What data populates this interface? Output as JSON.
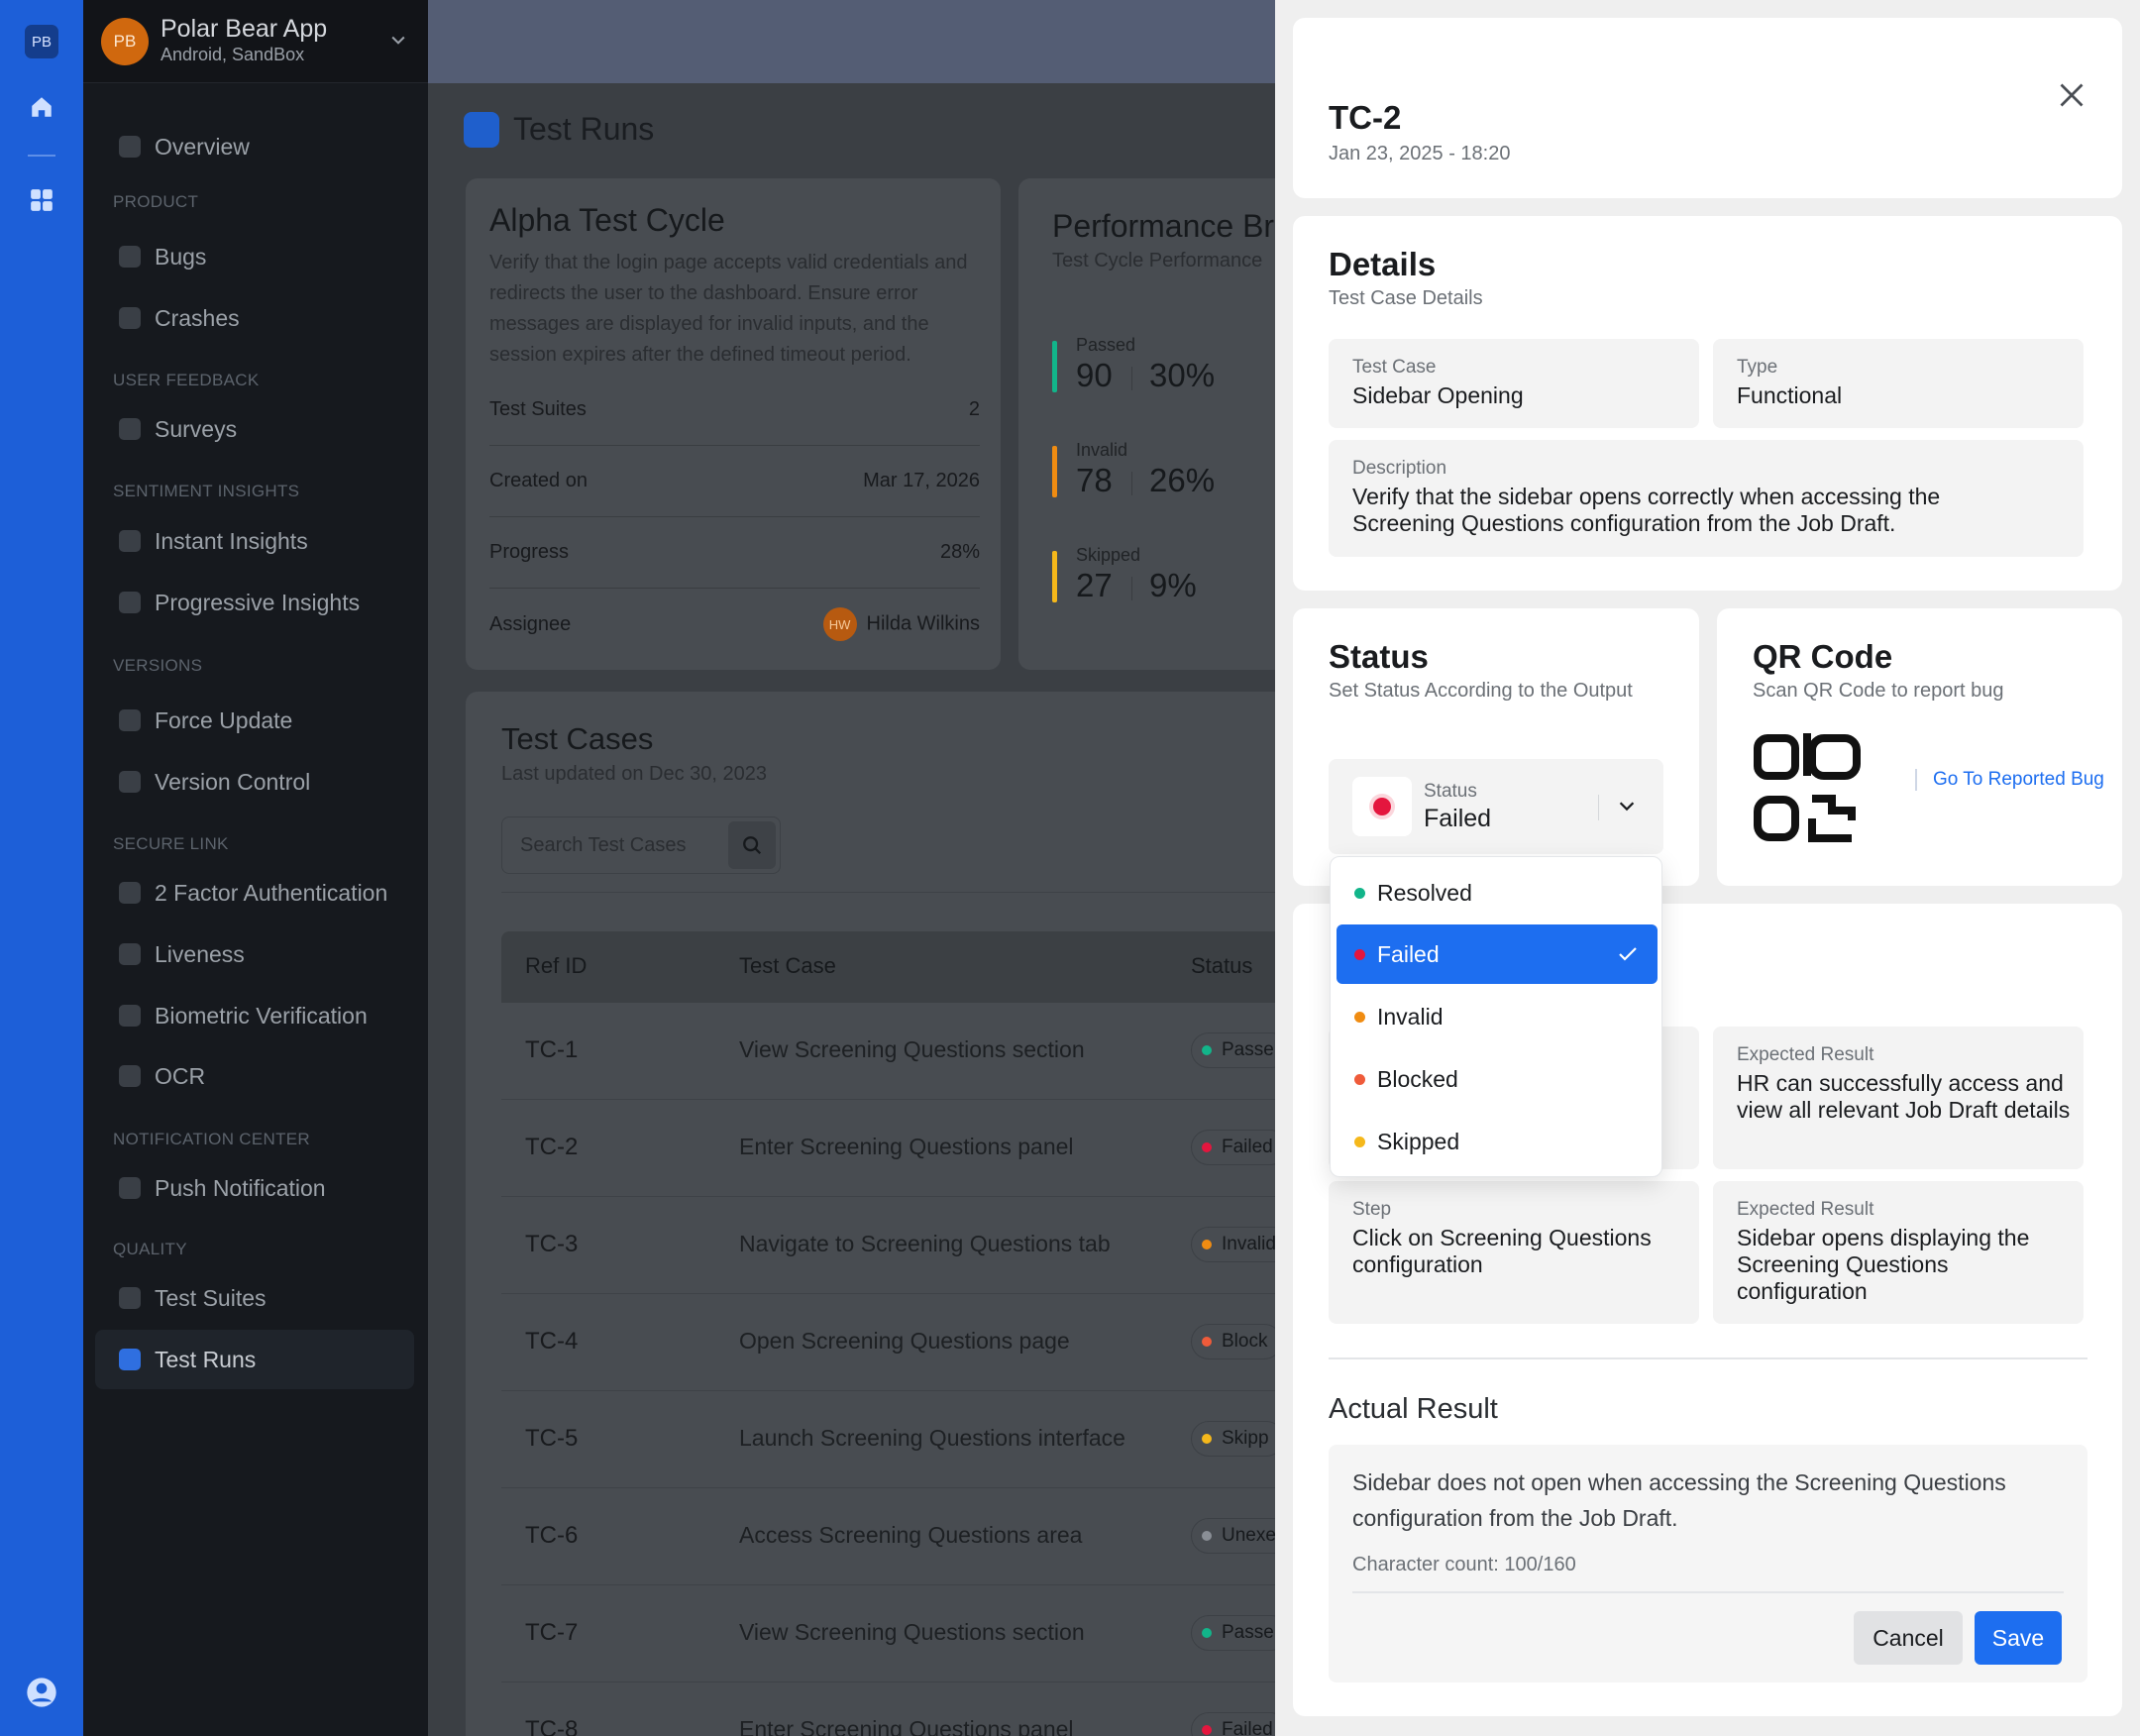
{
  "rail": {
    "logo": "PB"
  },
  "sidebar": {
    "app_initials": "PB",
    "app_name": "Polar Bear App",
    "app_sub": "Android, SandBox",
    "overview": "Overview",
    "sections": {
      "product": "PRODUCT",
      "user_feedback": "USER FEEDBACK",
      "sentiment": "SENTIMENT INSIGHTS",
      "versions": "VERSIONS",
      "secure_link": "SECURE LINK",
      "notification": "NOTIFICATION CENTER",
      "quality": "QUALITY"
    },
    "items": {
      "bugs": "Bugs",
      "crashes": "Crashes",
      "surveys": "Surveys",
      "instant": "Instant Insights",
      "progressive": "Progressive Insights",
      "force_update": "Force Update",
      "version_control": "Version Control",
      "two_factor": "2 Factor Authentication",
      "liveness": "Liveness",
      "biometric": "Biometric Verification",
      "ocr": "OCR",
      "push": "Push Notification",
      "test_suites": "Test Suites",
      "test_runs": "Test Runs"
    }
  },
  "main": {
    "page_title": "Test Runs",
    "cycle": {
      "title": "Alpha Test Cycle",
      "description": "Verify that the login page accepts valid credentials and redirects the user to the dashboard. Ensure error messages are displayed for invalid inputs, and the session expires after the defined timeout period.",
      "suites_label": "Test Suites",
      "suites_value": "2",
      "created_label": "Created on",
      "created_value": "Mar 17, 2026",
      "progress_label": "Progress",
      "progress_value": "28%",
      "assignee_label": "Assignee",
      "assignee_initials": "HW",
      "assignee_name": "Hilda Wilkins"
    },
    "performance": {
      "title": "Performance Br",
      "subtitle": "Test Cycle Performance",
      "stats": [
        {
          "label": "Passed",
          "value": "90",
          "pct": "30%",
          "color": "#12b58a"
        },
        {
          "label": "Invalid",
          "value": "78",
          "pct": "26%",
          "color": "#f08c12"
        },
        {
          "label": "Skipped",
          "value": "27",
          "pct": "9%",
          "color": "#f5b81b"
        }
      ]
    },
    "test_cases": {
      "title": "Test Cases",
      "updated": "Last updated on Dec 30, 2023",
      "search_placeholder": "Search Test Cases",
      "headers": {
        "ref": "Ref ID",
        "case": "Test Case",
        "status": "Status"
      },
      "rows": [
        {
          "id": "TC-1",
          "name": "View Screening Questions section",
          "status": "Passe",
          "color": "#12b58a"
        },
        {
          "id": "TC-2",
          "name": "Enter Screening Questions panel",
          "status": "Failed",
          "color": "#e4163e"
        },
        {
          "id": "TC-3",
          "name": "Navigate to Screening Questions tab",
          "status": "Invalid",
          "color": "#f08c12"
        },
        {
          "id": "TC-4",
          "name": "Open Screening Questions page",
          "status": "Block",
          "color": "#ef5b3a"
        },
        {
          "id": "TC-5",
          "name": "Launch Screening Questions interface",
          "status": "Skipp",
          "color": "#f5b81b"
        },
        {
          "id": "TC-6",
          "name": "Access Screening Questions area",
          "status": "Unexe",
          "color": "#8a8f96"
        },
        {
          "id": "TC-7",
          "name": "View Screening Questions section",
          "status": "Passe",
          "color": "#12b58a"
        },
        {
          "id": "TC-8",
          "name": "Enter Screening Questions panel",
          "status": "Failed",
          "color": "#e4163e"
        }
      ]
    }
  },
  "drawer": {
    "title": "TC-2",
    "date": "Jan 23, 2025 - 18:20",
    "details": {
      "title": "Details",
      "subtitle": "Test Case Details",
      "case_label": "Test Case",
      "case_value": "Sidebar Opening",
      "type_label": "Type",
      "type_value": "Functional",
      "desc_label": "Description",
      "desc_value": "Verify that the sidebar opens correctly when accessing the Screening Questions configuration from the Job Draft."
    },
    "status": {
      "title": "Status",
      "subtitle": "Set Status According to the Output",
      "field_label": "Status",
      "field_value": "Failed",
      "options": [
        {
          "label": "Resolved",
          "color": "#12b58a",
          "selected": false
        },
        {
          "label": "Failed",
          "color": "#e4163e",
          "selected": true
        },
        {
          "label": "Invalid",
          "color": "#f08c12",
          "selected": false
        },
        {
          "label": "Blocked",
          "color": "#ef5b3a",
          "selected": false
        },
        {
          "label": "Skipped",
          "color": "#f5b81b",
          "selected": false
        }
      ]
    },
    "qr": {
      "title": "QR Code",
      "subtitle": "Scan QR Code to report bug",
      "link": "Go To Reported Bug"
    },
    "steps": {
      "er1_label": "Expected Result",
      "er1_value": "HR can successfully access and view all relevant Job Draft details",
      "step2_label": "Step",
      "step2_value": "Click on Screening Questions configuration",
      "er2_label": "Expected Result",
      "er2_value": "Sidebar opens displaying the Screening Questions configuration"
    },
    "actual": {
      "title": "Actual Result",
      "text": "Sidebar does not open when accessing the Screening Questions configuration from the Job Draft.",
      "count": "Character count: 100/160",
      "cancel": "Cancel",
      "save": "Save"
    }
  }
}
